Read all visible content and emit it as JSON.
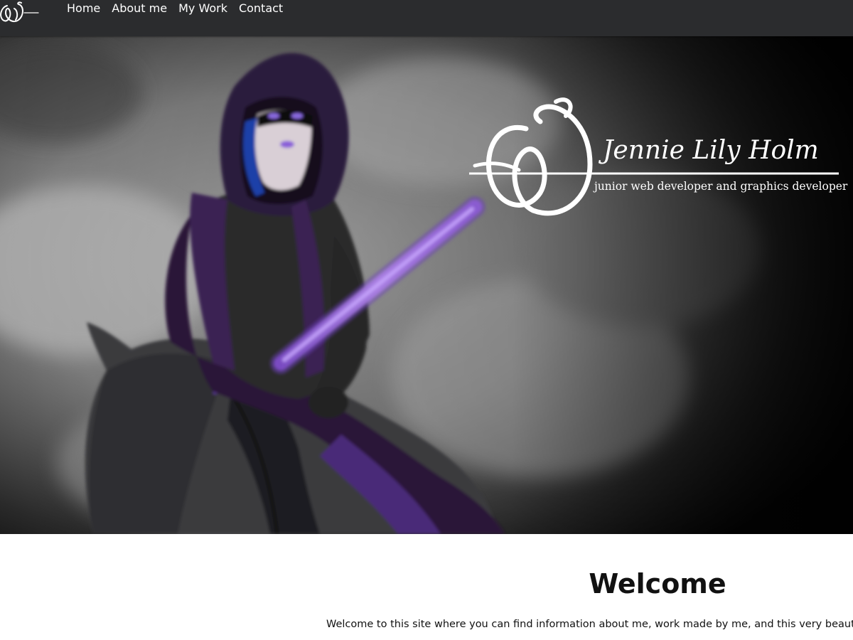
{
  "nav": {
    "links": [
      "Home",
      "About me",
      "My Work",
      "Contact"
    ]
  },
  "hero": {
    "brand_name": "Jennie Lily Holm",
    "tagline": "junior web developer and graphics developer"
  },
  "content": {
    "title": "Welcome",
    "intro": "Welcome to this site where you can find information about me, work made by me, and this very beautiful"
  },
  "colors": {
    "navbar": "#2b2c2e",
    "accent_purple": "#8f5fd0",
    "hood_purple": "#2c1a3d"
  },
  "icons": [
    "jlh-logo-icon"
  ]
}
